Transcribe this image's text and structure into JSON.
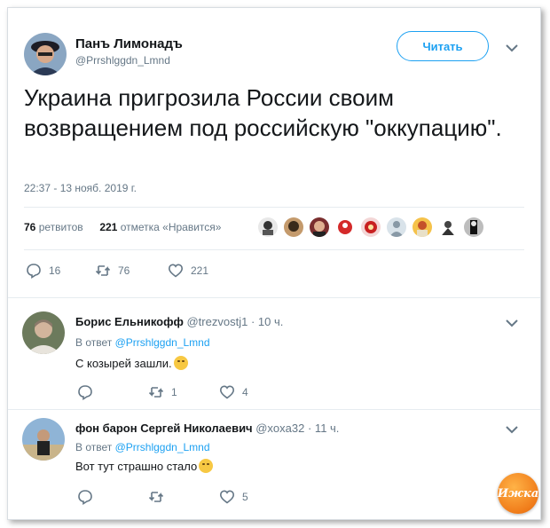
{
  "tweet": {
    "author_name": "Панъ Лимонадъ",
    "author_handle": "@Prrshlggdn_Lmnd",
    "follow_label": "Читать",
    "text": "Украина пригрозила России своим возвращением под российскую \"оккупацию\".",
    "timestamp": "22:37 - 13 нояб. 2019 г.",
    "retweets_count": "76",
    "retweets_label": "ретвитов",
    "likes_count": "221",
    "likes_label": "отметка «Нравится»",
    "liker_avatars": [
      "avatar-1",
      "avatar-2",
      "avatar-3",
      "avatar-4",
      "avatar-5",
      "avatar-6",
      "avatar-7",
      "avatar-8",
      "avatar-9"
    ],
    "actions": {
      "replies": "16",
      "retweets": "76",
      "likes": "221"
    }
  },
  "replies": [
    {
      "author_name": "Борис Ельникофф",
      "author_handle": "@trezvostj1",
      "time": "· 10 ч.",
      "reply_to_prefix": "В ответ",
      "reply_to_handle": "@Prrshlggdn_Lmnd",
      "text": "С козырей зашли.",
      "actions": {
        "replies": "",
        "retweets": "1",
        "likes": "4"
      }
    },
    {
      "author_name": "фон барон Сергей Николаевич",
      "author_handle": "@xoxa32",
      "time": "· 11 ч.",
      "reply_to_prefix": "В ответ",
      "reply_to_handle": "@Prrshlggdn_Lmnd",
      "text": "Вот тут страшно стало",
      "actions": {
        "replies": "",
        "retweets": "",
        "likes": "5"
      }
    }
  ],
  "watermark": "Ижка",
  "colors": {
    "accent": "#1da1f2",
    "muted": "#657786",
    "text": "#14171a",
    "divider": "#e6ecf0"
  }
}
